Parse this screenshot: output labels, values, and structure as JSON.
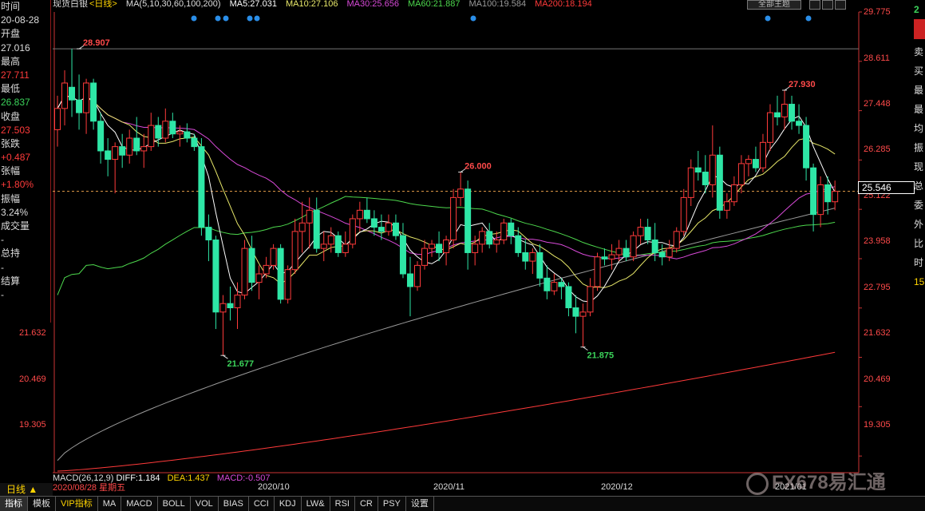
{
  "header": {
    "symbol": "现货白银",
    "period_tag": "<日线>",
    "ma_params": "MA(5,10,30,60,100,200)",
    "ma5": "MA5:27.031",
    "ma10": "MA10:27.106",
    "ma30": "MA30:25.656",
    "ma60": "MA60:21.887",
    "ma100": "MA100:19.584",
    "ma200": "MA200:18.194",
    "theme_button": "全部主题"
  },
  "colors": {
    "up": "#ff3b3b",
    "down": "#2ee6a6",
    "ma5": "#ffffff",
    "ma10": "#e8e86a",
    "ma30": "#d84ad8",
    "ma60": "#4dd84d",
    "ma100": "#9a9a9a",
    "ma200": "#ff3a3a",
    "event_dot": "#2a8ee8"
  },
  "info_panel": {
    "time_label": "时间",
    "time_value": "20-08-28",
    "open_label": "开盘",
    "open_value": "27.016",
    "high_label": "最高",
    "high_value": "27.711",
    "low_label": "最低",
    "low_value": "26.837",
    "close_label": "收盘",
    "close_value": "27.503",
    "change_label": "张跌",
    "change_value": "+0.487",
    "pct_label": "张幅",
    "pct_value": "+1.80%",
    "amp_label": "振幅",
    "amp_value": "3.24%",
    "vol_label": "成交量",
    "vol_value": "-",
    "oi_label": "总持",
    "oi_value": "-",
    "settle_label": "结算",
    "settle_value": "-"
  },
  "right_panel": {
    "items": [
      "2",
      "卖",
      "买",
      "最",
      "最",
      "均",
      "振",
      "现",
      "总",
      "委",
      "外",
      "比",
      "时",
      "15"
    ]
  },
  "right_axis": [
    "29.775",
    "28.611",
    "27.448",
    "26.285",
    "25.122",
    "23.958",
    "22.795",
    "21.632",
    "20.469",
    "19.305"
  ],
  "left_axis": [
    "21.632",
    "20.469",
    "19.305"
  ],
  "current_price": "25.546",
  "annotations": {
    "high1": "28.907",
    "low1": "21.677",
    "high2": "26.000",
    "low2": "21.875",
    "high3": "27.930"
  },
  "macd": {
    "params": "MACD(26,12,9)",
    "diff": "DIFF:1.184",
    "dea": "DEA:1.437",
    "macd": "MACD:-0.507"
  },
  "bottom": {
    "period_label": "日线 ▲",
    "date_label": "2020/08/28 星期五",
    "x_labels": [
      "2020/10",
      "2020/11",
      "2020/12",
      "2021/01"
    ],
    "tabs": [
      "指标",
      "模板",
      "VIP指标",
      "MA",
      "MACD",
      "BOLL",
      "VOL",
      "BIAS",
      "CCI",
      "KDJ",
      "LW&",
      "RSI",
      "CR",
      "PSY",
      "设置"
    ]
  },
  "watermark": "FX678易汇通",
  "chart_data": {
    "type": "candlestick",
    "ylim": [
      18.95,
      29.775
    ],
    "candles": [
      [
        27.0,
        27.8,
        26.6,
        27.5
      ],
      [
        27.5,
        28.4,
        27.1,
        28.1
      ],
      [
        28.0,
        28.907,
        27.3,
        27.7
      ],
      [
        27.7,
        28.3,
        27.0,
        27.4
      ],
      [
        27.4,
        28.2,
        26.9,
        28.1
      ],
      [
        28.1,
        28.2,
        27.0,
        27.2
      ],
      [
        27.2,
        27.4,
        26.2,
        26.5
      ],
      [
        26.5,
        26.8,
        25.9,
        26.3
      ],
      [
        26.3,
        26.7,
        25.5,
        26.6
      ],
      [
        26.6,
        26.9,
        26.1,
        26.4
      ],
      [
        26.4,
        27.0,
        26.2,
        26.8
      ],
      [
        26.8,
        27.3,
        26.4,
        26.5
      ],
      [
        26.5,
        26.9,
        26.1,
        26.6
      ],
      [
        26.6,
        27.4,
        26.5,
        27.1
      ],
      [
        27.1,
        27.3,
        26.6,
        26.8
      ],
      [
        26.8,
        27.5,
        26.7,
        27.2
      ],
      [
        27.2,
        27.4,
        26.8,
        26.9
      ],
      [
        26.9,
        27.1,
        26.6,
        26.95
      ],
      [
        26.95,
        27.15,
        26.7,
        26.8
      ],
      [
        26.8,
        26.9,
        26.5,
        26.6
      ],
      [
        26.6,
        26.8,
        24.5,
        24.7
      ],
      [
        24.7,
        25.0,
        23.9,
        24.4
      ],
      [
        24.4,
        24.5,
        22.3,
        22.7
      ],
      [
        22.7,
        23.1,
        21.677,
        22.9
      ],
      [
        22.9,
        23.3,
        22.5,
        22.8
      ],
      [
        22.8,
        23.4,
        22.3,
        23.1
      ],
      [
        23.1,
        24.4,
        23.0,
        24.2
      ],
      [
        24.2,
        24.5,
        23.2,
        23.4
      ],
      [
        23.4,
        23.8,
        23.0,
        23.6
      ],
      [
        23.6,
        24.0,
        23.5,
        23.8
      ],
      [
        23.8,
        24.3,
        23.7,
        24.2
      ],
      [
        24.2,
        24.3,
        22.9,
        23.0
      ],
      [
        23.0,
        23.8,
        22.9,
        23.7
      ],
      [
        23.7,
        24.9,
        23.6,
        24.6
      ],
      [
        24.6,
        25.3,
        24.1,
        24.8
      ],
      [
        24.8,
        25.4,
        24.2,
        25.1
      ],
      [
        25.1,
        25.4,
        24.1,
        24.2
      ],
      [
        24.2,
        24.6,
        23.9,
        24.3
      ],
      [
        24.3,
        24.7,
        24.1,
        24.5
      ],
      [
        24.5,
        24.6,
        24.0,
        24.1
      ],
      [
        24.1,
        24.6,
        24.0,
        24.3
      ],
      [
        24.3,
        25.0,
        24.2,
        24.9
      ],
      [
        24.9,
        25.3,
        24.6,
        25.1
      ],
      [
        25.1,
        25.4,
        24.8,
        24.9
      ],
      [
        24.9,
        25.1,
        24.5,
        24.7
      ],
      [
        24.7,
        25.0,
        24.4,
        24.6
      ],
      [
        24.6,
        25.0,
        24.5,
        24.8
      ],
      [
        24.8,
        25.0,
        24.4,
        24.5
      ],
      [
        24.5,
        24.8,
        23.5,
        23.6
      ],
      [
        23.6,
        24.0,
        22.6,
        23.3
      ],
      [
        23.3,
        23.9,
        23.2,
        23.8
      ],
      [
        23.8,
        24.4,
        23.7,
        24.2
      ],
      [
        24.2,
        24.4,
        24.0,
        24.3
      ],
      [
        24.3,
        24.6,
        23.9,
        24.1
      ],
      [
        24.1,
        24.5,
        23.8,
        24.4
      ],
      [
        24.4,
        25.6,
        24.2,
        25.4
      ],
      [
        25.4,
        26.0,
        25.2,
        25.6
      ],
      [
        25.6,
        25.8,
        23.7,
        24.1
      ],
      [
        24.1,
        24.5,
        23.8,
        24.3
      ],
      [
        24.3,
        24.7,
        24.1,
        24.6
      ],
      [
        24.6,
        24.8,
        24.2,
        24.3
      ],
      [
        24.3,
        24.6,
        24.1,
        24.4
      ],
      [
        24.4,
        24.9,
        24.3,
        24.8
      ],
      [
        24.8,
        24.9,
        24.3,
        24.5
      ],
      [
        24.5,
        24.7,
        24.0,
        24.1
      ],
      [
        24.1,
        24.4,
        23.7,
        23.9
      ],
      [
        23.9,
        24.2,
        23.6,
        24.1
      ],
      [
        24.1,
        24.3,
        23.3,
        23.5
      ],
      [
        23.5,
        23.8,
        23.0,
        23.2
      ],
      [
        23.2,
        23.6,
        23.1,
        23.4
      ],
      [
        23.4,
        23.5,
        23.0,
        23.3
      ],
      [
        23.3,
        23.4,
        22.6,
        22.8
      ],
      [
        22.8,
        23.1,
        22.2,
        22.6
      ],
      [
        22.6,
        22.9,
        21.875,
        22.7
      ],
      [
        22.7,
        23.5,
        22.6,
        23.3
      ],
      [
        23.3,
        24.1,
        23.2,
        24.0
      ],
      [
        24.0,
        24.2,
        23.8,
        23.95
      ],
      [
        23.95,
        24.3,
        23.7,
        24.05
      ],
      [
        24.05,
        24.4,
        23.9,
        24.2
      ],
      [
        24.2,
        24.4,
        23.9,
        24.0
      ],
      [
        24.0,
        24.6,
        23.9,
        24.5
      ],
      [
        24.5,
        24.9,
        24.3,
        24.7
      ],
      [
        24.7,
        24.9,
        24.3,
        24.4
      ],
      [
        24.4,
        24.8,
        23.9,
        24.1
      ],
      [
        24.1,
        24.3,
        23.8,
        24.0
      ],
      [
        24.0,
        24.4,
        23.9,
        24.2
      ],
      [
        24.2,
        24.7,
        24.1,
        24.6
      ],
      [
        24.6,
        25.6,
        24.5,
        25.4
      ],
      [
        25.4,
        26.3,
        25.2,
        26.1
      ],
      [
        26.1,
        26.5,
        25.8,
        26.0
      ],
      [
        26.0,
        26.4,
        25.5,
        25.7
      ],
      [
        25.7,
        27.1,
        25.4,
        26.4
      ],
      [
        26.4,
        26.6,
        24.9,
        25.1
      ],
      [
        25.1,
        25.5,
        24.9,
        25.3
      ],
      [
        25.3,
        25.9,
        25.2,
        25.7
      ],
      [
        25.7,
        26.4,
        25.5,
        26.2
      ],
      [
        26.2,
        26.4,
        25.9,
        26.3
      ],
      [
        26.3,
        26.6,
        26.0,
        26.1
      ],
      [
        26.1,
        26.9,
        26.0,
        26.7
      ],
      [
        26.7,
        27.6,
        26.5,
        27.4
      ],
      [
        27.4,
        27.8,
        27.1,
        27.3
      ],
      [
        27.3,
        27.93,
        27.0,
        27.6
      ],
      [
        27.6,
        27.8,
        27.0,
        27.2
      ],
      [
        27.2,
        27.6,
        26.9,
        27.1
      ],
      [
        27.1,
        27.3,
        25.8,
        26.1
      ],
      [
        26.1,
        26.2,
        24.6,
        25.0
      ],
      [
        25.0,
        25.9,
        24.7,
        25.7
      ],
      [
        25.7,
        25.9,
        25.0,
        25.3
      ],
      [
        25.3,
        25.8,
        25.1,
        25.546
      ]
    ]
  }
}
